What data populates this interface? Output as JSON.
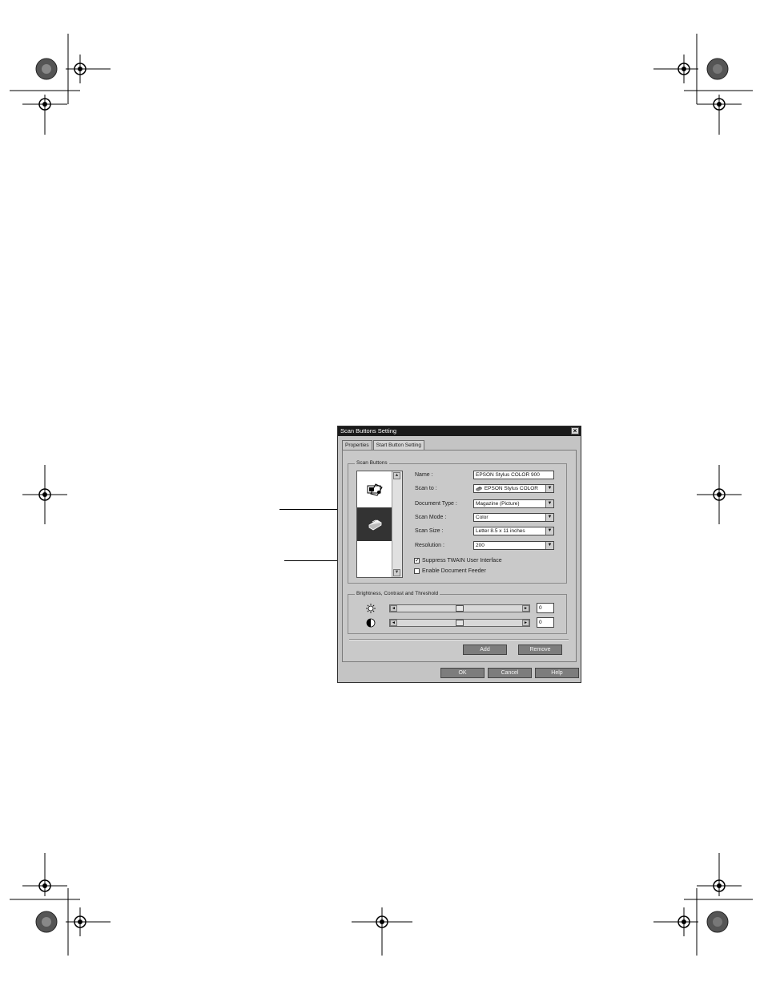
{
  "dialog": {
    "title": "Scan Buttons Setting",
    "close_glyph": "×",
    "tabs": [
      {
        "label": "Properties"
      },
      {
        "label": "Start Button Setting"
      }
    ],
    "scan_buttons": {
      "group_title": "Scan Buttons",
      "list_items": [
        {
          "icon": "scanner-image-icon"
        },
        {
          "icon": "printer-icon",
          "selected": true
        }
      ],
      "scroll_up": "▲",
      "scroll_down": "▼"
    },
    "fields": {
      "name": {
        "label": "Name :",
        "value": "EPSON Stylus COLOR 900"
      },
      "scan_to": {
        "label": "Scan to :",
        "value": "EPSON Stylus COLOR"
      },
      "document_type": {
        "label": "Document Type :",
        "value": "Magazine (Picture)"
      },
      "scan_mode": {
        "label": "Scan Mode :",
        "value": "Color"
      },
      "scan_size": {
        "label": "Scan Size :",
        "value": "Letter 8.5 x 11 inches"
      },
      "resolution": {
        "label": "Resolution :",
        "value": "200"
      }
    },
    "dropdown_arrow": "▼",
    "checkboxes": [
      {
        "label": "Suppress TWAIN User Interface",
        "checked": true,
        "mark": "✓"
      },
      {
        "label": "Enable Document Feeder",
        "checked": false,
        "mark": ""
      }
    ],
    "adjust": {
      "group_title": "Brightness, Contrast and Threshold",
      "sliders": [
        {
          "icon": "brightness-icon",
          "value": "0",
          "level": 0.5
        },
        {
          "icon": "contrast-icon",
          "value": "0",
          "level": 0.5
        }
      ],
      "left_arrow": "◄",
      "right_arrow": "►"
    },
    "buttons": {
      "add": "Add",
      "remove": "Remove",
      "ok": "OK",
      "cancel": "Cancel",
      "help": "Help"
    }
  }
}
